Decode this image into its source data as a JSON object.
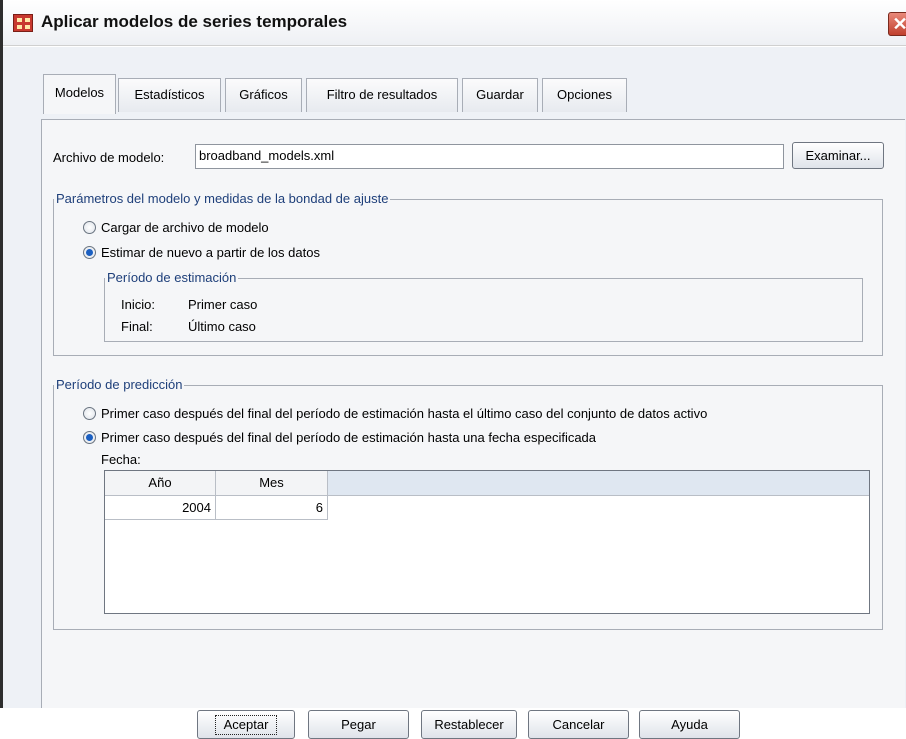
{
  "window": {
    "title": "Aplicar modelos de series temporales",
    "close_glyph": "✕"
  },
  "tabs": [
    {
      "label": "Modelos",
      "active": true
    },
    {
      "label": "Estadísticos"
    },
    {
      "label": "Gráficos"
    },
    {
      "label": "Filtro de resultados"
    },
    {
      "label": "Guardar"
    },
    {
      "label": "Opciones"
    }
  ],
  "model_file": {
    "label": "Archivo de modelo:",
    "value": "broadband_models.xml",
    "browse_label": "Examinar..."
  },
  "parameters": {
    "legend": "Parámetros del modelo y medidas de la bondad de ajuste",
    "option_load": "Cargar de archivo de modelo",
    "option_reestimate": "Estimar de nuevo a partir de los datos",
    "selected": "reestimate",
    "estimation_period": {
      "legend": "Período de estimación",
      "start_label": "Inicio:",
      "start_value": "Primer caso",
      "end_label": "Final:",
      "end_value": "Último caso"
    }
  },
  "forecast": {
    "legend": "Período de predicción",
    "option_active": "Primer caso después del final del período de estimación hasta el último caso del conjunto de datos activo",
    "option_date": "Primer caso después del final del período de estimación hasta una fecha especificada",
    "selected": "date",
    "date_label": "Fecha:",
    "columns": [
      "Año",
      "Mes"
    ],
    "values": [
      "2004",
      "6"
    ]
  },
  "buttons": {
    "ok": "Aceptar",
    "paste": "Pegar",
    "reset": "Restablecer",
    "cancel": "Cancelar",
    "help": "Ayuda"
  },
  "colors": {
    "accent": "#1b5fc1",
    "group_legend": "#1e3f7a",
    "panel_bg": "#f5f6f8"
  }
}
